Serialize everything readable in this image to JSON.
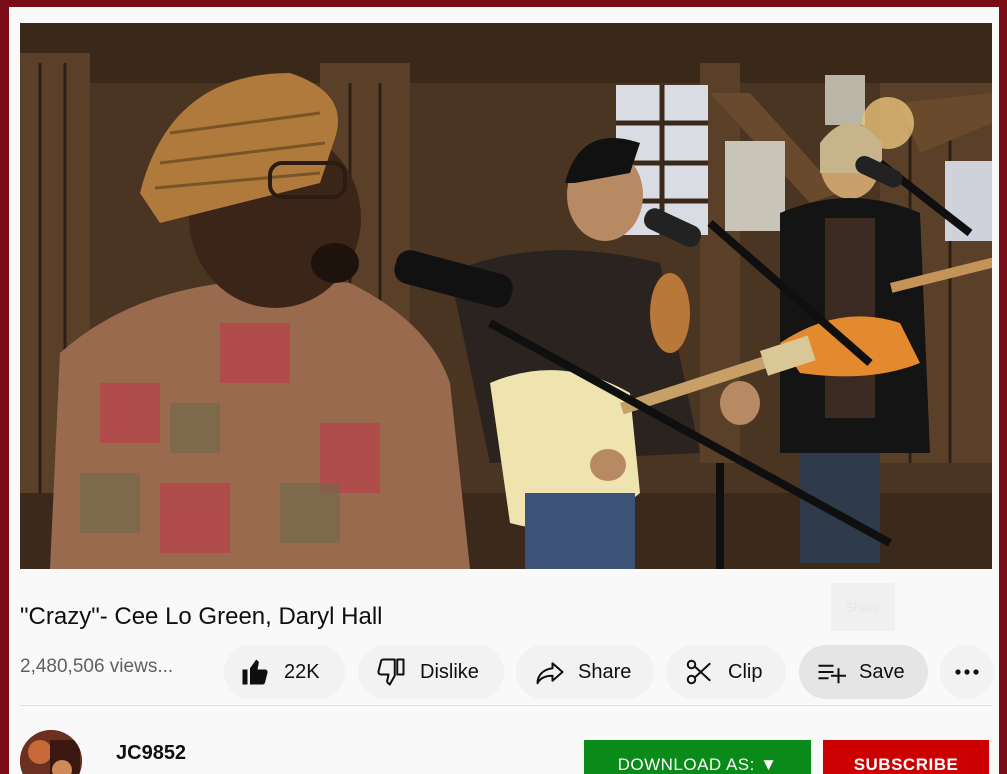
{
  "video": {
    "title": "\"Crazy\"- Cee Lo Green, Daryl Hall",
    "views": "2,480,506 views..."
  },
  "ghost_button": {
    "label": "Share"
  },
  "actions": {
    "like_count": "22K",
    "dislike_label": "Dislike",
    "share_label": "Share",
    "clip_label": "Clip",
    "save_label": "Save"
  },
  "channel": {
    "name": "JC9852"
  },
  "buttons": {
    "download_label": "DOWNLOAD AS: ▼",
    "subscribe_label": "SUBSCRIBE"
  },
  "colors": {
    "page_border": "#7a0c18",
    "download_bg": "#0a8a18",
    "subscribe_bg": "#cc0000"
  },
  "icons": [
    "thumbs-up-icon",
    "thumbs-down-icon",
    "share-arrow-icon",
    "scissors-icon",
    "playlist-add-icon",
    "more-dots-icon"
  ]
}
